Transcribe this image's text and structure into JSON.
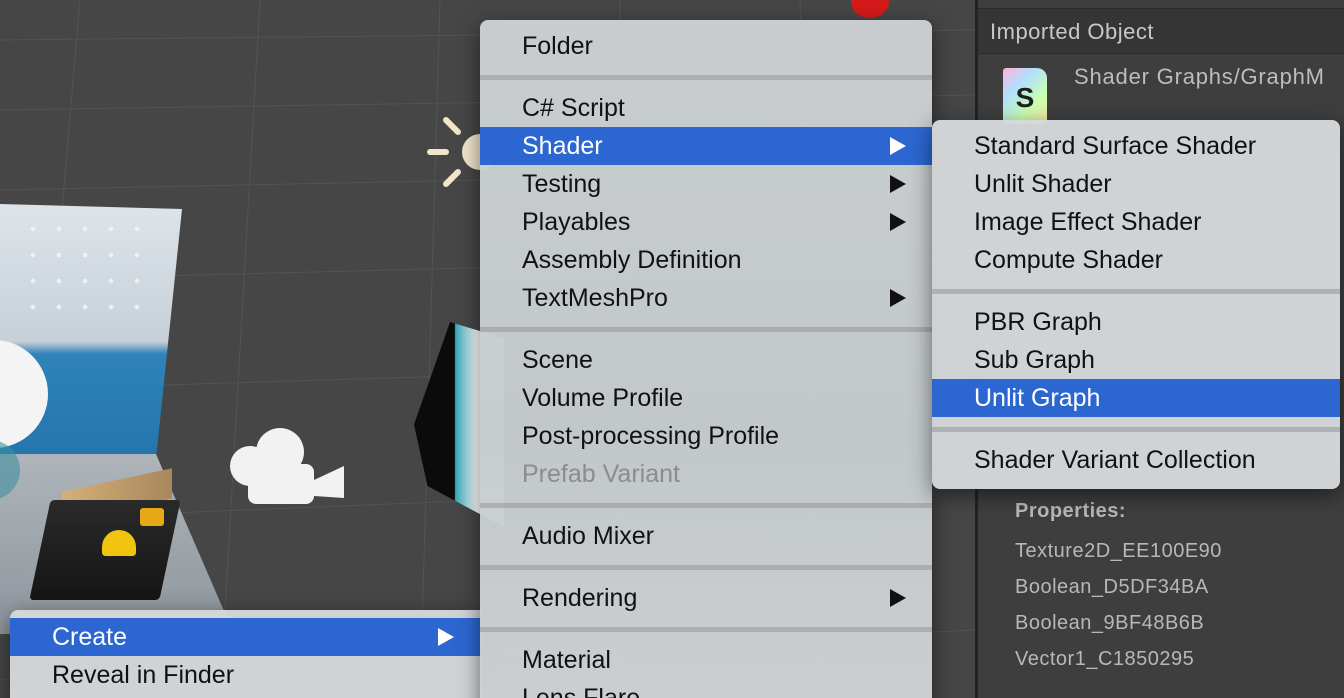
{
  "inspector": {
    "header": "Imported Object",
    "asset_path": "Shader Graphs/GraphM",
    "file_icon_letter": "S",
    "properties_title": "Properties:",
    "properties": [
      "Texture2D_EE100E90",
      "Boolean_D5DF34BA",
      "Boolean_9BF48B6B",
      "Vector1_C1850295"
    ]
  },
  "asset_menu": {
    "items": [
      {
        "label": "Create",
        "highlighted": true,
        "submenu": true
      },
      {
        "label": "Reveal in Finder"
      }
    ]
  },
  "create_menu": {
    "items": [
      {
        "label": "Folder"
      },
      {
        "label": "C# Script"
      },
      {
        "label": "Shader",
        "highlighted": true,
        "submenu": true
      },
      {
        "label": "Testing",
        "submenu": true
      },
      {
        "label": "Playables",
        "submenu": true
      },
      {
        "label": "Assembly Definition"
      },
      {
        "label": "TextMeshPro",
        "submenu": true
      },
      {
        "label": "Scene"
      },
      {
        "label": "Volume Profile"
      },
      {
        "label": "Post-processing Profile"
      },
      {
        "label": "Prefab Variant",
        "disabled": true
      },
      {
        "label": "Audio Mixer"
      },
      {
        "label": "Rendering",
        "submenu": true
      },
      {
        "label": "Material"
      },
      {
        "label": "Lens Flare"
      }
    ]
  },
  "shader_menu": {
    "items": [
      {
        "label": "Standard Surface Shader"
      },
      {
        "label": "Unlit Shader"
      },
      {
        "label": "Image Effect Shader"
      },
      {
        "label": "Compute Shader"
      },
      {
        "label": "PBR Graph"
      },
      {
        "label": "Sub Graph"
      },
      {
        "label": "Unlit Graph",
        "highlighted": true
      },
      {
        "label": "Shader Variant Collection"
      }
    ]
  },
  "colors": {
    "highlight": "#2c67d1",
    "scene_bg": "#464646",
    "inspector_bg": "#3e3e3e"
  }
}
